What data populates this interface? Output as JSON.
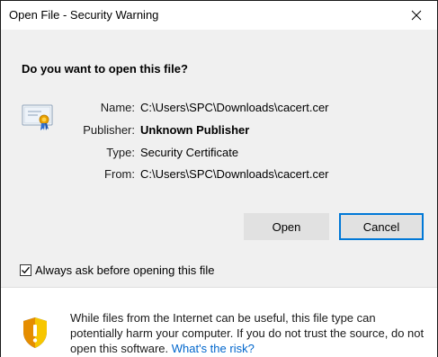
{
  "window": {
    "title": "Open File - Security Warning",
    "close_glyph": "✕"
  },
  "question": "Do you want to open this file?",
  "file_info": [
    {
      "label": "Name:",
      "value": "C:\\Users\\SPC\\Downloads\\cacert.cer",
      "bold": false
    },
    {
      "label": "Publisher:",
      "value": "Unknown Publisher",
      "bold": true
    },
    {
      "label": "Type:",
      "value": "Security Certificate",
      "bold": false
    },
    {
      "label": "From:",
      "value": "C:\\Users\\SPC\\Downloads\\cacert.cer",
      "bold": false
    }
  ],
  "buttons": {
    "open_label": "Open",
    "cancel_label": "Cancel"
  },
  "checkbox": {
    "label": "Always ask before opening this file",
    "checked": true
  },
  "warning": {
    "text": "While files from the Internet can be useful, this file type can potentially harm your computer. If you do not trust the source, do not open this software.",
    "link_text": "What's the risk?"
  },
  "icons": {
    "certificate": "certificate-icon",
    "shield": "shield-warning-icon",
    "close": "close-icon",
    "check": "checkmark-icon"
  },
  "colors": {
    "link": "#0066cc",
    "focus_border": "#0078d7",
    "panel_bg": "#f0f0f0",
    "shield_yellow": "#f7c600"
  }
}
